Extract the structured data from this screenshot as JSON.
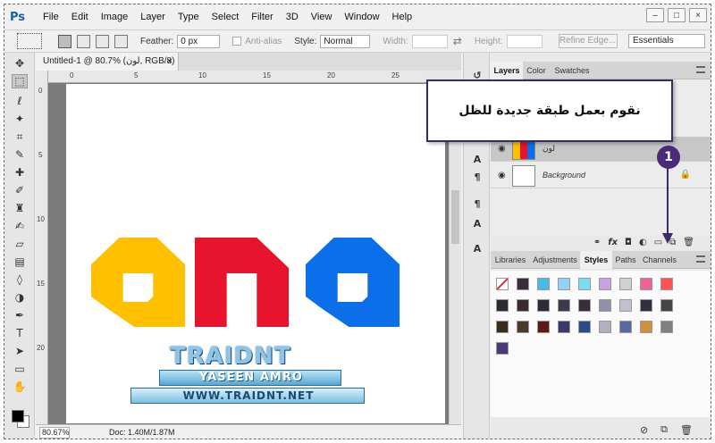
{
  "app": {
    "logo": "Ps",
    "menu": [
      "File",
      "Edit",
      "Image",
      "Layer",
      "Type",
      "Select",
      "Filter",
      "3D",
      "View",
      "Window",
      "Help"
    ],
    "window_controls": [
      "–",
      "□",
      "×"
    ]
  },
  "options_bar": {
    "feather_label": "Feather:",
    "feather_value": "0 px",
    "antialias_label": "Anti-alias",
    "style_label": "Style:",
    "style_value": "Normal",
    "width_label": "Width:",
    "height_label": "Height:",
    "refine_edge": "Refine Edge...",
    "workspace": "Essentials"
  },
  "toolbar": {
    "tools": [
      "move-icon",
      "marquee-icon",
      "lasso-icon",
      "magic-wand-icon",
      "crop-icon",
      "eyedropper-icon",
      "healing-icon",
      "brush-icon",
      "clone-stamp-icon",
      "history-brush-icon",
      "eraser-icon",
      "gradient-icon",
      "blur-icon",
      "dodge-icon",
      "pen-icon",
      "type-icon",
      "path-select-icon",
      "shape-icon",
      "hand-icon",
      "zoom-icon"
    ]
  },
  "document": {
    "tab_title": "Untitled-1 @ 80.7% (لون, RGB/8) *",
    "tab_close": "×",
    "ruler_h": [
      "0",
      "5",
      "10",
      "15",
      "20",
      "25"
    ],
    "ruler_v": [
      "0",
      "5",
      "10",
      "15",
      "20"
    ],
    "zoom": "80.67%",
    "doc_info": "Doc: 1.40M/1.87M",
    "watermark_top": "TRAIDNT",
    "watermark_mid": "YASEEN AMRO",
    "watermark_url": "WWW.TRAIDNT.NET",
    "letter_colors": [
      "#FFC000",
      "#E8142E",
      "#0A6FE8"
    ]
  },
  "layers_panel": {
    "tabs": [
      "Layers",
      "Color",
      "Swatches"
    ],
    "layers": [
      {
        "name": "لون",
        "visible": true
      },
      {
        "name": "Background",
        "visible": true,
        "locked": true
      }
    ],
    "bottom_icons": [
      "link-icon",
      "fx-icon",
      "mask-icon",
      "adjustment-icon",
      "folder-icon",
      "new-layer-icon",
      "trash-icon"
    ],
    "fx_label": "fx"
  },
  "styles_panel": {
    "tabs": [
      "Libraries",
      "Adjustments",
      "Styles",
      "Paths",
      "Channels"
    ]
  },
  "callout": {
    "text": "نقوم بعمل طبقة جديدة للظل",
    "step": "1"
  }
}
